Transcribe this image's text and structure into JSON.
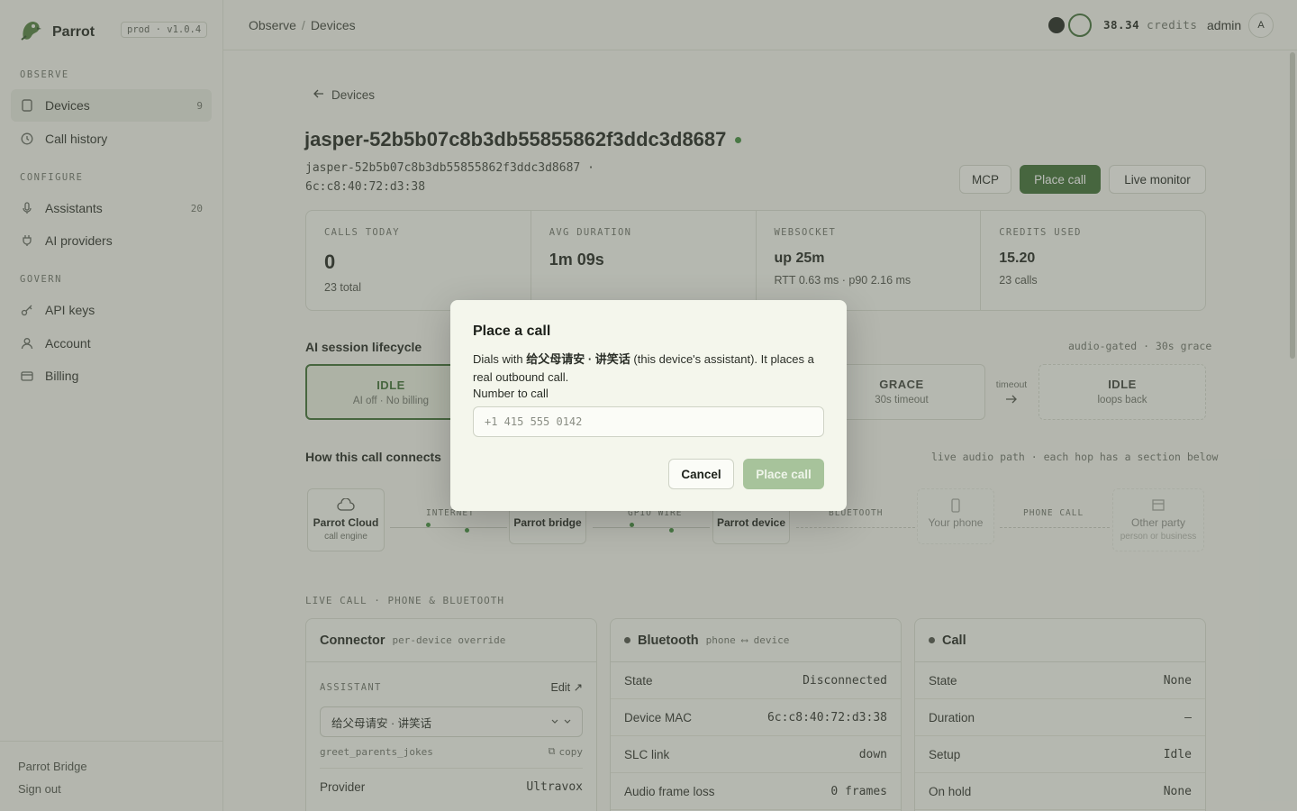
{
  "app": {
    "name": "Parrot",
    "env_badge": "prod · v1.0.4"
  },
  "sidebar": {
    "sections": [
      {
        "title": "OBSERVE"
      },
      {
        "title": "CONFIGURE"
      },
      {
        "title": "GOVERN"
      }
    ],
    "items": [
      {
        "label": "Devices",
        "count": "9",
        "icon": "device-icon"
      },
      {
        "label": "Call history",
        "count": "",
        "icon": "clock-icon"
      },
      {
        "label": "Assistants",
        "count": "20",
        "icon": "microphone-icon"
      },
      {
        "label": "AI providers",
        "count": "",
        "icon": "plug-icon"
      },
      {
        "label": "API keys",
        "count": "",
        "icon": "key-icon"
      },
      {
        "label": "Account",
        "count": "",
        "icon": "user-icon"
      },
      {
        "label": "Billing",
        "count": "",
        "icon": "credit-card-icon"
      }
    ],
    "footer": {
      "bridge": "Parrot Bridge",
      "signout": "Sign out"
    }
  },
  "topbar": {
    "breadcrumb": [
      "Observe",
      "Devices"
    ],
    "credits_value": "38.34",
    "credits_unit": "credits",
    "user": "admin",
    "avatar": "A"
  },
  "device": {
    "back_label": "Devices",
    "title": "jasper-52b5b07c8b3db55855862f3ddc3d8687",
    "subtitle_line1": "jasper-52b5b07c8b3db55855862f3ddc3d8687 ·",
    "subtitle_line2": "6c:c8:40:72:d3:38",
    "buttons": {
      "mcp": "MCP",
      "place_call": "Place call",
      "live_monitor": "Live monitor"
    }
  },
  "stats": [
    {
      "label": "CALLS TODAY",
      "value": "0",
      "sub": "23 total"
    },
    {
      "label": "AVG DURATION",
      "value": "1m 09s",
      "sub": ""
    },
    {
      "label": "WEBSOCKET",
      "value": "up 25m",
      "sub": "RTT 0.63 ms · p90 2.16 ms"
    },
    {
      "label": "CREDITS USED",
      "value": "15.20",
      "sub": "23 calls"
    }
  ],
  "lifecycle": {
    "title": "AI session lifecycle",
    "meta": "audio-gated · 30s grace",
    "stages": [
      {
        "title": "IDLE",
        "sub": "AI off · No billing"
      },
      {
        "title": "GRACE",
        "sub": "30s timeout"
      },
      {
        "title": "IDLE",
        "sub": "loops back"
      }
    ],
    "transition_label": "timeout"
  },
  "connects": {
    "title": "How this call connects",
    "meta": "live audio path · each hop has a section below",
    "hops": [
      {
        "title": "Parrot Cloud",
        "sub": "call engine"
      },
      {
        "title": "Parrot bridge",
        "sub": ""
      },
      {
        "title": "Parrot device",
        "sub": ""
      },
      {
        "title": "Your phone",
        "sub": ""
      },
      {
        "title": "Other party",
        "sub": "person or business"
      }
    ],
    "links": [
      "INTERNET",
      "GPIO WIRE",
      "BLUETOOTH",
      "PHONE CALL"
    ]
  },
  "live_call_label": "LIVE CALL · PHONE & BLUETOOTH",
  "connector": {
    "title": "Connector",
    "meta": "per-device override",
    "assistant_label": "ASSISTANT",
    "edit_label": "Edit ↗",
    "assistant_value": "给父母请安 · 讲笑话",
    "slug": "greet_parents_jokes",
    "copy_label": "copy",
    "rows": [
      {
        "k": "Provider",
        "v": "Ultravox"
      }
    ]
  },
  "bluetooth": {
    "title": "Bluetooth",
    "meta": "phone ⟷ device",
    "rows": [
      {
        "k": "State",
        "v": "Disconnected"
      },
      {
        "k": "Device MAC",
        "v": "6c:c8:40:72:d3:38"
      },
      {
        "k": "SLC link",
        "v": "down"
      },
      {
        "k": "Audio frame loss",
        "v": "0 frames"
      }
    ]
  },
  "call": {
    "title": "Call",
    "rows": [
      {
        "k": "State",
        "v": "None"
      },
      {
        "k": "Duration",
        "v": "–"
      },
      {
        "k": "Setup",
        "v": "Idle"
      },
      {
        "k": "On hold",
        "v": "None"
      }
    ]
  },
  "modal": {
    "title": "Place a call",
    "desc_prefix": "Dials with ",
    "desc_assistant": "给父母请安 · 讲笑话",
    "desc_suffix": " (this device's assistant). It places a real outbound call.",
    "number_label": "Number to call",
    "number_placeholder": "+1 415 555 0142",
    "number_value": "",
    "cancel": "Cancel",
    "place": "Place call"
  },
  "colors": {
    "accent": "#3a6b30",
    "live": "#3d8a3a",
    "disabled_primary": "#a7c39b"
  }
}
